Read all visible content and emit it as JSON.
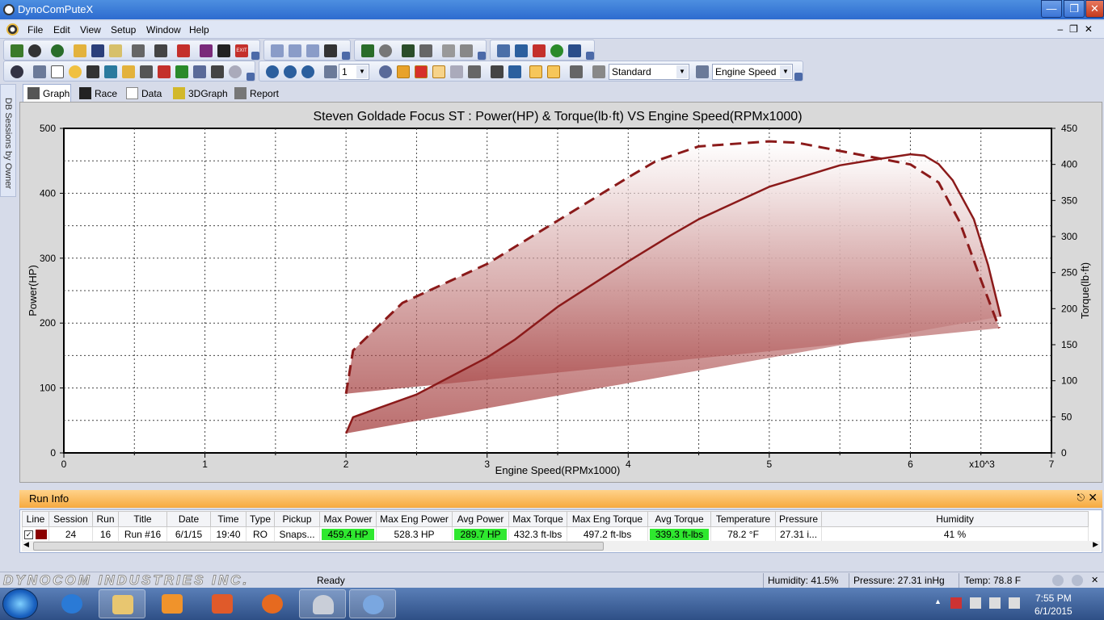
{
  "window": {
    "title": "DynoComPuteX"
  },
  "menu": [
    "File",
    "Edit",
    "View",
    "Setup",
    "Window",
    "Help"
  ],
  "toolbar": {
    "zoom_value": "1",
    "preset_value": "Standard",
    "xaxis_value": "Engine Speed"
  },
  "side_strip": {
    "label": "DB Sessions by Owner"
  },
  "tabs": [
    "Graph",
    "Race",
    "Data",
    "3DGraph",
    "Report"
  ],
  "chart_data": {
    "type": "line",
    "title": "Steven Goldade Focus ST : Power(HP) & Torque(lb·ft) VS Engine Speed(RPMx1000)",
    "xlabel": "Engine Speed(RPMx1000)",
    "x_multiplier_label": "x10^3",
    "ylabel_left": "Power(HP)",
    "ylabel_right": "Torque(lb·ft)",
    "xlim": [
      0,
      7
    ],
    "ylim_left": [
      0,
      500
    ],
    "ylim_right": [
      0,
      450
    ],
    "x_ticks": [
      "0",
      "1",
      "2",
      "3",
      "4",
      "5",
      "6",
      "7"
    ],
    "y_ticks_left": [
      "0",
      "100",
      "200",
      "300",
      "400",
      "500"
    ],
    "y_ticks_right": [
      "0",
      "50",
      "100",
      "150",
      "200",
      "250",
      "300",
      "350",
      "400",
      "450"
    ],
    "grid": true,
    "series": [
      {
        "axis": "left",
        "style": "solid",
        "color": "#8b1a1a",
        "x": [
          2.0,
          2.05,
          2.5,
          3.0,
          3.2,
          3.5,
          4.0,
          4.3,
          4.5,
          5.0,
          5.5,
          5.75,
          6.0,
          6.1,
          6.2,
          6.3,
          6.45,
          6.55,
          6.64
        ],
        "y": [
          30,
          55,
          90,
          147,
          175,
          225,
          295,
          335,
          360,
          410,
          443,
          452,
          460,
          458,
          445,
          420,
          360,
          290,
          210
        ]
      },
      {
        "axis": "right",
        "style": "dashed",
        "color": "#8b1a1a",
        "x": [
          2.0,
          2.05,
          2.4,
          3.0,
          3.5,
          4.0,
          4.2,
          4.5,
          5.0,
          5.2,
          5.6,
          6.0,
          6.2,
          6.35,
          6.5,
          6.63
        ],
        "y": [
          82,
          142,
          208,
          262,
          322,
          382,
          405,
          425,
          432,
          430,
          415,
          400,
          375,
          320,
          240,
          173
        ]
      }
    ]
  },
  "run_info": {
    "title": "Run Info",
    "columns": [
      "Line",
      "Session",
      "Run",
      "Title",
      "Date",
      "Time",
      "Type",
      "Pickup",
      "Max Power",
      "Max Eng Power",
      "Avg Power",
      "Max Torque",
      "Max Eng Torque",
      "Avg Torque",
      "Temperature",
      "Pressure",
      "Humidity"
    ],
    "row": [
      "",
      "24",
      "16",
      "Run #16",
      "6/1/15",
      "19:40",
      "RO",
      "Snaps...",
      "459.4 HP",
      "528.3 HP",
      "289.7 HP",
      "432.3 ft-lbs",
      "497.2 ft-lbs",
      "339.3 ft-lbs",
      "78.2 °F",
      "27.31 i...",
      "41 %"
    ],
    "line_color": "#8b0000",
    "highlight_color": "#2fe82f"
  },
  "status": {
    "brand": "DYNOCOM INDUSTRIES INC.",
    "ready": "Ready",
    "humidity": "Humidity: 41.5%",
    "pressure": "Pressure: 27.31 inHg",
    "temp": "Temp: 78.8 F"
  },
  "taskbar": {
    "time": "7:55 PM",
    "date": "6/1/2015"
  }
}
